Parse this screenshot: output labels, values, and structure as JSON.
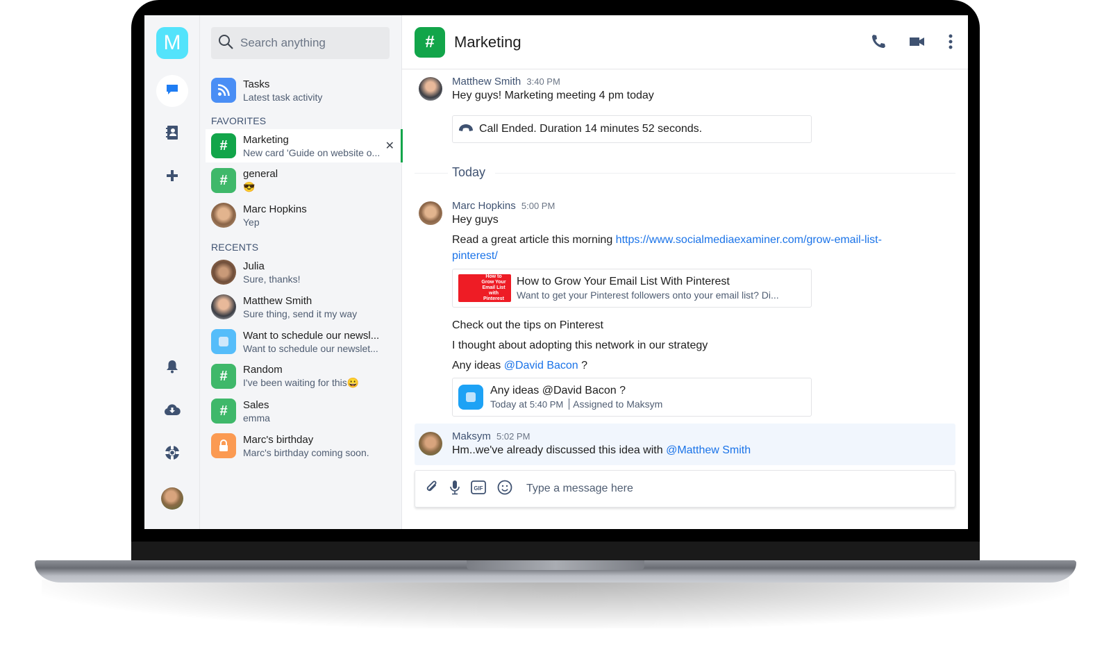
{
  "app": {
    "logo_letter": "M"
  },
  "rail": {
    "items": [
      {
        "name": "chats",
        "icon": "chat-bubble-icon",
        "active": true
      },
      {
        "name": "contacts",
        "icon": "contacts-book-icon"
      },
      {
        "name": "add",
        "icon": "plus-icon"
      },
      {
        "name": "notifications",
        "icon": "bell-icon"
      },
      {
        "name": "download",
        "icon": "cloud-download-icon"
      },
      {
        "name": "help",
        "icon": "lifebuoy-icon"
      }
    ]
  },
  "search": {
    "placeholder": "Search anything"
  },
  "tasks": {
    "title": "Tasks",
    "subtitle": "Latest task activity",
    "color": "#4a8ef5"
  },
  "favorites": {
    "title": "FAVORITES",
    "items": [
      {
        "title": "Marketing",
        "subtitle": "New card 'Guide on website o...",
        "icon": "hash",
        "color": "#12a54a",
        "selected": true
      },
      {
        "title": "general",
        "subtitle": "😎",
        "icon": "hash",
        "color": "#3fb86a"
      },
      {
        "title": "Marc Hopkins",
        "subtitle": "Yep",
        "icon": "avatar"
      }
    ]
  },
  "recents": {
    "title": "RECENTS",
    "items": [
      {
        "title": "Julia",
        "subtitle": "Sure, thanks!",
        "icon": "avatar"
      },
      {
        "title": "Matthew Smith",
        "subtitle": "Sure thing, send it my way",
        "icon": "avatar"
      },
      {
        "title": "Want to schedule our newsl...",
        "subtitle": "Want to schedule our newslet...",
        "icon": "task",
        "color": "#55bdfa"
      },
      {
        "title": "Random",
        "subtitle": "I've been waiting for this😀",
        "icon": "hash",
        "color": "#3fb86a"
      },
      {
        "title": "Sales",
        "subtitle": "emma",
        "icon": "hash",
        "color": "#3fb86a"
      },
      {
        "title": "Marc's birthday",
        "subtitle": "Marc's birthday coming soon.",
        "icon": "lock",
        "color": "#fb9a52"
      }
    ]
  },
  "chat": {
    "title": "Marketing",
    "channel_color": "#12a54a",
    "messages": [
      {
        "author": "Matthew Smith",
        "time": "3:40 PM",
        "text": "Hey guys! Marketing meeting 4 pm today",
        "call_card": "Call Ended. Duration 14 minutes 52 seconds."
      },
      {
        "divider": "Today"
      },
      {
        "author": "Marc Hopkins",
        "time": "5:00 PM",
        "lines": {
          "l1": "Hey guys",
          "l2_prefix": "Read a great article this morning ",
          "l2_link_a": "https://www.socialmediaexaminer.com/grow-email-list-",
          "l2_link_b": "pinterest/",
          "preview_title": "How to Grow Your Email List With Pinterest",
          "preview_desc": "Want to get your Pinterest followers onto your email list? Di...",
          "preview_thumb_text": "How to Grow Your Email List with Pinterest",
          "l3": "Check out the tips on Pinterest",
          "l4": "I thought about adopting this network in our strategy",
          "l5_prefix": "Any ideas ",
          "l5_mention": "@David Bacon",
          "l5_suffix": " ?",
          "task_title": "Any ideas @David Bacon ?",
          "task_meta_prefix": "Today at ",
          "task_time": "5:40 PM",
          "task_assigned": "Assigned to Maksym"
        }
      },
      {
        "author": "Maksym",
        "time": "5:02 PM",
        "text_prefix": "Hm..we've already discussed this idea with ",
        "mention": "@Matthew Smith"
      }
    ]
  },
  "composer": {
    "placeholder": "Type a message here"
  },
  "colors": {
    "accent": "#12a54a",
    "link": "#1a73e8",
    "icon": "#3f5271",
    "logo": "#53e3fb"
  }
}
